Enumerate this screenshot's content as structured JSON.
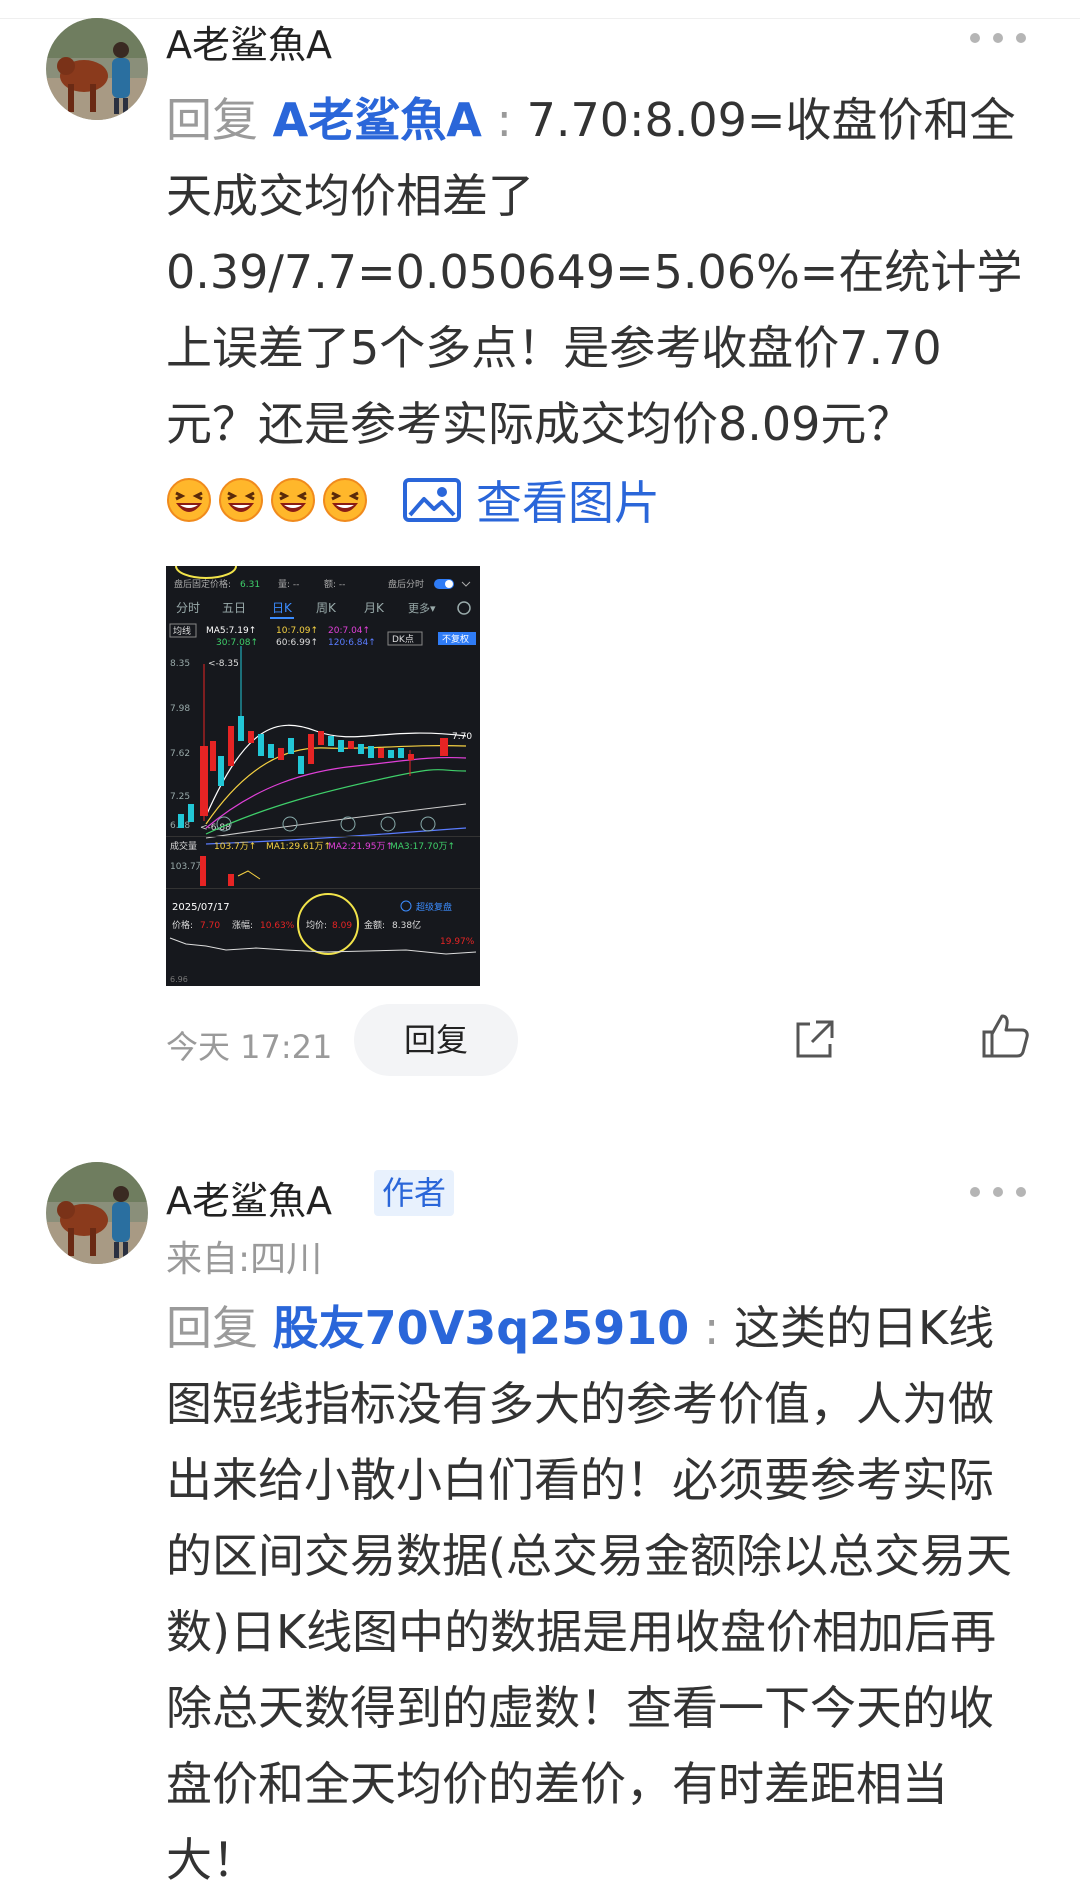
{
  "comment1": {
    "username": "A老鲨魚A",
    "reply_word": "回复",
    "mention": "A老鲨魚A",
    "colon": " : ",
    "text": "7.70:8.09=收盘价和全天成交均价相差了0.39/7.7=0.050649=5.06%=在统计学上误差了5个多点！是参考收盘价7.70元？还是参考实际成交均价8.09元？",
    "emojis": [
      "laugh-emoji",
      "laugh-emoji",
      "laugh-emoji",
      "laugh-emoji"
    ],
    "view_image_label": "查看图片",
    "time": "今天 17:21",
    "reply_button": "回复",
    "icons": {
      "share": "share-icon",
      "like": "thumbs-up-icon",
      "more": "more-dots-icon"
    }
  },
  "stock_image": {
    "top_label": "盘后固定价格:",
    "top_price": "6.31",
    "top_vol": "量: --",
    "top_amt": "额: --",
    "top_toggle": "盘后分时",
    "tabs": [
      "分时",
      "五日",
      "日K",
      "周K",
      "月K",
      "更多▾"
    ],
    "active_tab": "日K",
    "ma_label": "均线",
    "ma5": "MA5:7.19↑",
    "ma10": "10:7.09↑",
    "ma20": "20:7.04↑",
    "ma30": "30:7.08↑",
    "ma60": "60:6.99↑",
    "ma120": "120:6.84↑",
    "dk": "DK点",
    "no_adjust": "不复权",
    "price_ticks": [
      "8.35",
      "7.98",
      "7.62",
      "7.25",
      "6.88"
    ],
    "high_marker": "<-8.35",
    "low_marker": "<-6.88",
    "last_price": "7.70",
    "vol_label": "成交量",
    "vol_value": "103.7万↑",
    "vol_ma1": "MA1:29.61万↑",
    "vol_ma2": "MA2:21.95万↑",
    "vol_ma3": "MA3:17.70万↑",
    "vol_axis": "103.7万",
    "date": "2025/07/17",
    "super_replay": "超级复盘",
    "price_label": "价格:",
    "price_value": "7.70",
    "change_label": "涨幅:",
    "change_value": "10.63%",
    "avg_label": "均价:",
    "avg_value": "8.09",
    "amount_label": "金额:",
    "amount_value": "8.38亿",
    "pct_value": "19.97%",
    "bottom_left": "6.96"
  },
  "comment2": {
    "username": "A老鲨魚A",
    "author_tag": "作者",
    "from": "来自:四川",
    "reply_word": "回复",
    "mention": "股友70V3q25910",
    "colon": " : ",
    "text": "这类的日K线图短线指标没有多大的参考价值，人为做出来给小散小白们看的！必须要参考实际的区间交易数据(总交易金额除以总交易天数)日K线图中的数据是用收盘价相加后再除总天数得到的虚数！查看一下今天的收盘价和全天均价的差价，有时差距相当大！"
  },
  "colors": {
    "accent": "#2a66d9",
    "muted": "#9a9a9a",
    "up": "#e62424",
    "down": "#22c7d6"
  }
}
